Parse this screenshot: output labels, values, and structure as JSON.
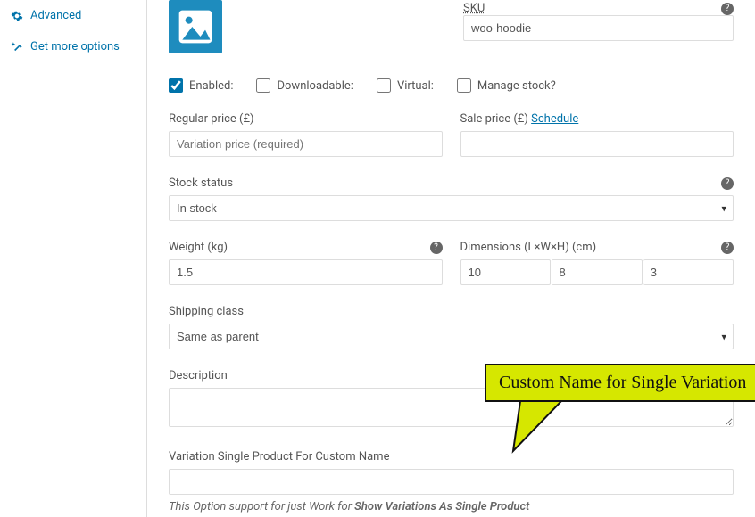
{
  "sidebar": {
    "advanced": "Advanced",
    "get_more": "Get more options"
  },
  "sku": {
    "label": "SKU",
    "value": "woo-hoodie"
  },
  "checks": {
    "enabled": "Enabled:",
    "downloadable": "Downloadable:",
    "virtual": "Virtual:",
    "manage_stock": "Manage stock?"
  },
  "regular_price": {
    "label": "Regular price (£)",
    "placeholder": "Variation price (required)",
    "value": ""
  },
  "sale_price": {
    "label": "Sale price (£)",
    "schedule": "Schedule",
    "value": ""
  },
  "stock_status": {
    "label": "Stock status",
    "value": "In stock"
  },
  "weight": {
    "label": "Weight (kg)",
    "value": "1.5"
  },
  "dimensions": {
    "label": "Dimensions (L×W×H) (cm)",
    "l": "10",
    "w": "8",
    "h": "3"
  },
  "shipping_class": {
    "label": "Shipping class",
    "value": "Same as parent"
  },
  "description": {
    "label": "Description",
    "value": ""
  },
  "custom_name": {
    "label": "Variation Single Product For Custom Name",
    "value": ""
  },
  "hint": {
    "pre": "This Option support for just Work for ",
    "bold": "Show Variations As Single Product"
  },
  "callout": "Custom Name for Single Variation"
}
